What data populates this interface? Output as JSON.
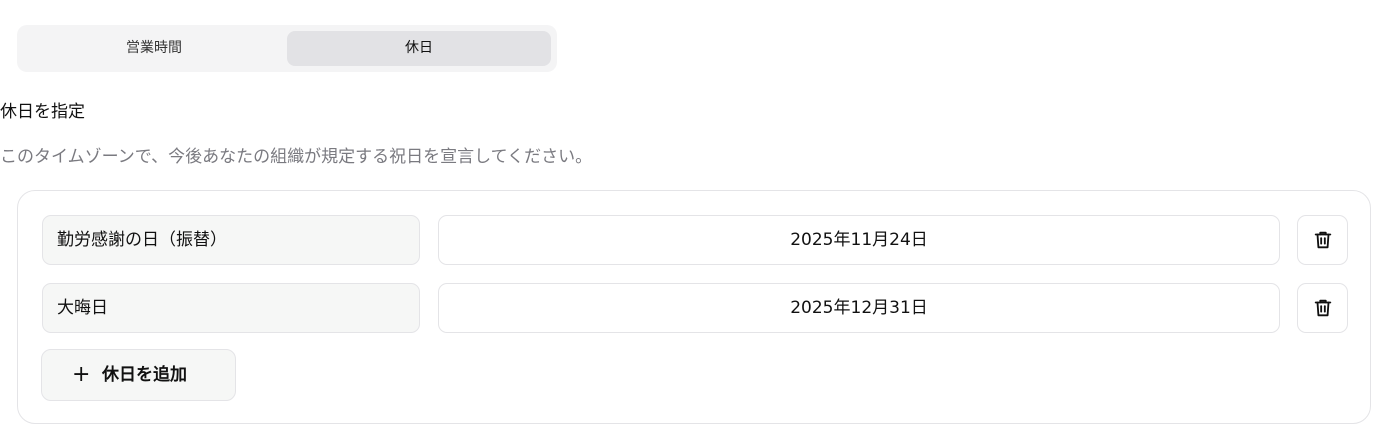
{
  "tabs": [
    {
      "label": "営業時間",
      "selected": false
    },
    {
      "label": "休日",
      "selected": true
    }
  ],
  "section": {
    "title": "休日を指定",
    "description": "このタイムゾーンで、今後あなたの組織が規定する祝日を宣言してください。"
  },
  "holidays": [
    {
      "name": "勤労感謝の日（振替）",
      "date": "2025年11月24日"
    },
    {
      "name": "大晦日",
      "date": "2025年12月31日"
    }
  ],
  "add_button": {
    "label": "休日を追加",
    "icon": "plus-icon"
  },
  "icons": {
    "delete": "trash-icon"
  },
  "colors": {
    "selected_tab_bg": "#e2e2e5",
    "segmented_bg": "#f4f4f5",
    "muted_text": "#7a7a80",
    "border": "#e4e4e7"
  }
}
